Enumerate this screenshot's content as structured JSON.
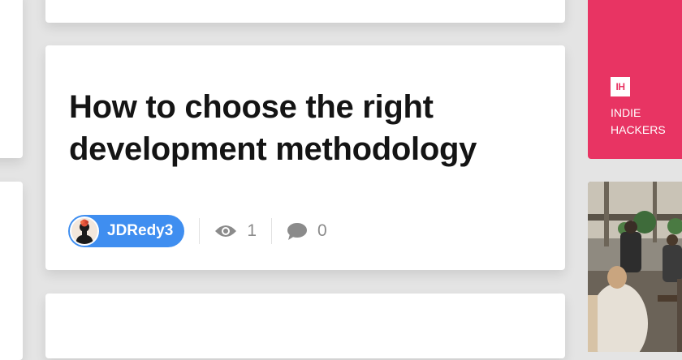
{
  "post": {
    "title": "How to choose the right development methodology",
    "author": "JDRedy3",
    "views": "1",
    "comments": "0"
  },
  "promo": {
    "logo": "IH",
    "name": "INDIE\nHACKERS",
    "color": "#e83463"
  },
  "icons": {
    "views": "eye-icon",
    "comments": "speech-bubble-icon"
  }
}
